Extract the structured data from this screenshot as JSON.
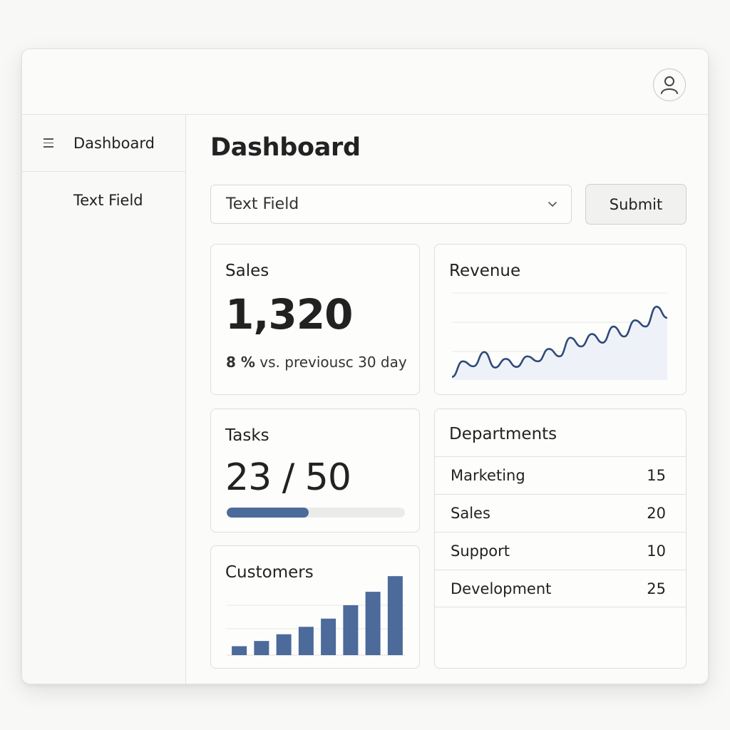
{
  "header": {
    "avatar_icon": "user-icon"
  },
  "sidebar": {
    "menu_icon": "menu-icon",
    "items": [
      {
        "label": "Dashboard"
      },
      {
        "label": "Text Field"
      }
    ]
  },
  "main": {
    "title": "Dashboard",
    "select": {
      "value": "Text Field",
      "icon": "chevron-down-icon"
    },
    "submit_label": "Submit"
  },
  "cards": {
    "sales": {
      "title": "Sales",
      "value": "1,320",
      "change": "8 %",
      "change_text": "vs. previousc 30 day"
    },
    "revenue": {
      "title": "Revenue"
    },
    "tasks": {
      "title": "Tasks",
      "value": "23 / 50",
      "progress_fraction": 0.46
    },
    "customers": {
      "title": "Customers"
    },
    "departments": {
      "title": "Departments",
      "rows": [
        {
          "name": "Marketing",
          "value": "15"
        },
        {
          "name": "Sales",
          "value": "20"
        },
        {
          "name": "Support",
          "value": "10"
        },
        {
          "name": "Development",
          "value": "25"
        }
      ]
    }
  },
  "colors": {
    "accent": "#4c6a9a",
    "line": "#2f4a7a",
    "area": "#eef2f8"
  },
  "chart_data": [
    {
      "type": "area",
      "title": "Revenue",
      "x": [
        0,
        1,
        2,
        3,
        4,
        5,
        6,
        7,
        8,
        9,
        10,
        11,
        12,
        13,
        14,
        15,
        16,
        17,
        18,
        19,
        20
      ],
      "values": [
        5,
        30,
        22,
        45,
        20,
        34,
        21,
        38,
        30,
        50,
        38,
        68,
        54,
        74,
        60,
        86,
        70,
        96,
        86,
        118,
        100
      ],
      "ylim": [
        0,
        140
      ],
      "grid": true
    },
    {
      "type": "bar",
      "title": "Customers",
      "categories": [
        "1",
        "2",
        "3",
        "4",
        "5",
        "6",
        "7",
        "8"
      ],
      "values": [
        12,
        19,
        28,
        38,
        49,
        67,
        85,
        106
      ],
      "ylim": [
        0,
        110
      ],
      "grid": true
    }
  ]
}
